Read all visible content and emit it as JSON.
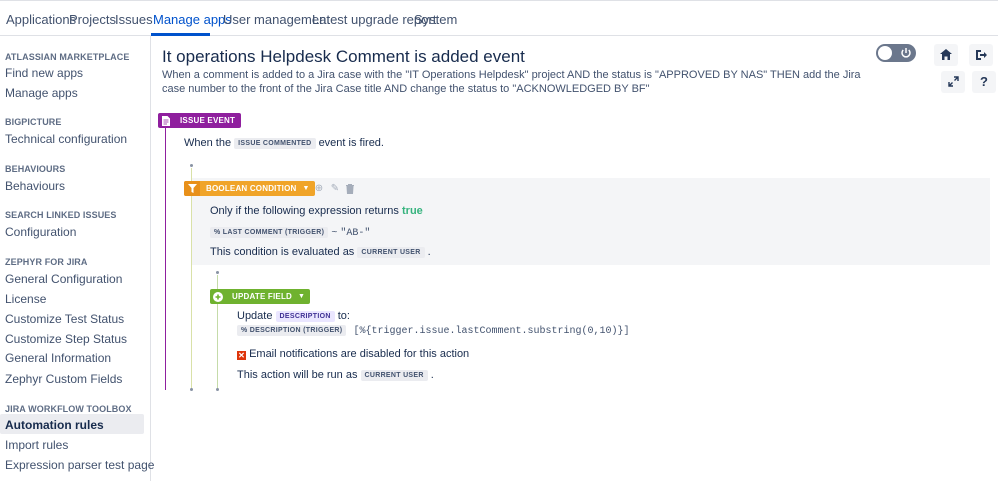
{
  "nav": {
    "tabs": [
      "Applications",
      "Projects",
      "Issues",
      "Manage apps",
      "User management",
      "Latest upgrade report",
      "System"
    ],
    "active": "Manage apps"
  },
  "sidebar": {
    "sections": [
      {
        "heading": "ATLASSIAN MARKETPLACE",
        "items": [
          "Find new apps",
          "Manage apps"
        ]
      },
      {
        "heading": "BIGPICTURE",
        "items": [
          "Technical configuration"
        ]
      },
      {
        "heading": "BEHAVIOURS",
        "items": [
          "Behaviours"
        ]
      },
      {
        "heading": "SEARCH LINKED ISSUES",
        "items": [
          "Configuration"
        ]
      },
      {
        "heading": "ZEPHYR FOR JIRA",
        "items": [
          "General Configuration",
          "License",
          "Customize Test Status",
          "Customize Step Status",
          "General Information",
          "Zephyr Custom Fields"
        ]
      },
      {
        "heading": "JIRA WORKFLOW TOOLBOX",
        "items": [
          "Automation rules",
          "Import rules",
          "Expression parser test page"
        ]
      }
    ],
    "active_item": "Automation rules"
  },
  "header": {
    "title": "It operations Helpdesk Comment is added event",
    "description": "When a comment is added to a Jira case with the \"IT Operations Helpdesk\" project AND the status is \"APPROVED BY NAS\" THEN add the Jira case number to the front of the Jira Case title AND change the status to \"ACKNOWLEDGED BY BF\""
  },
  "toolbar": {
    "toggle_icon": "power-icon",
    "buttons": [
      "home-icon",
      "exit-icon",
      "expand-icon",
      "help-icon"
    ],
    "help_label": "?"
  },
  "event": {
    "label": "ISSUE EVENT",
    "text_before": "When the",
    "chip": "ISSUE COMMENTED",
    "text_after": "event is fired.",
    "color": "#8f1f9e"
  },
  "condition": {
    "label": "BOOLEAN CONDITION",
    "line1_before": "Only if the following expression returns",
    "line1_value": "true",
    "chip": "% LAST COMMENT (TRIGGER)",
    "operator": "~",
    "string": "\"AB-\"",
    "eval_before": "This condition is evaluated as",
    "eval_chip": "CURRENT USER",
    "eval_after": ".",
    "color": "#f5a623"
  },
  "action": {
    "label": "UPDATE FIELD",
    "update_before": "Update",
    "update_chip": "DESCRIPTION",
    "update_after": "to:",
    "value_chip": "% DESCRIPTION (TRIGGER)",
    "value_expr": "[%{trigger.issue.lastComment.substring(0,10)}]",
    "email_note": "Email notifications are disabled for this action",
    "run_before": "This action will be run as",
    "run_chip": "CURRENT USER",
    "run_after": ".",
    "color": "#6fb22f"
  }
}
